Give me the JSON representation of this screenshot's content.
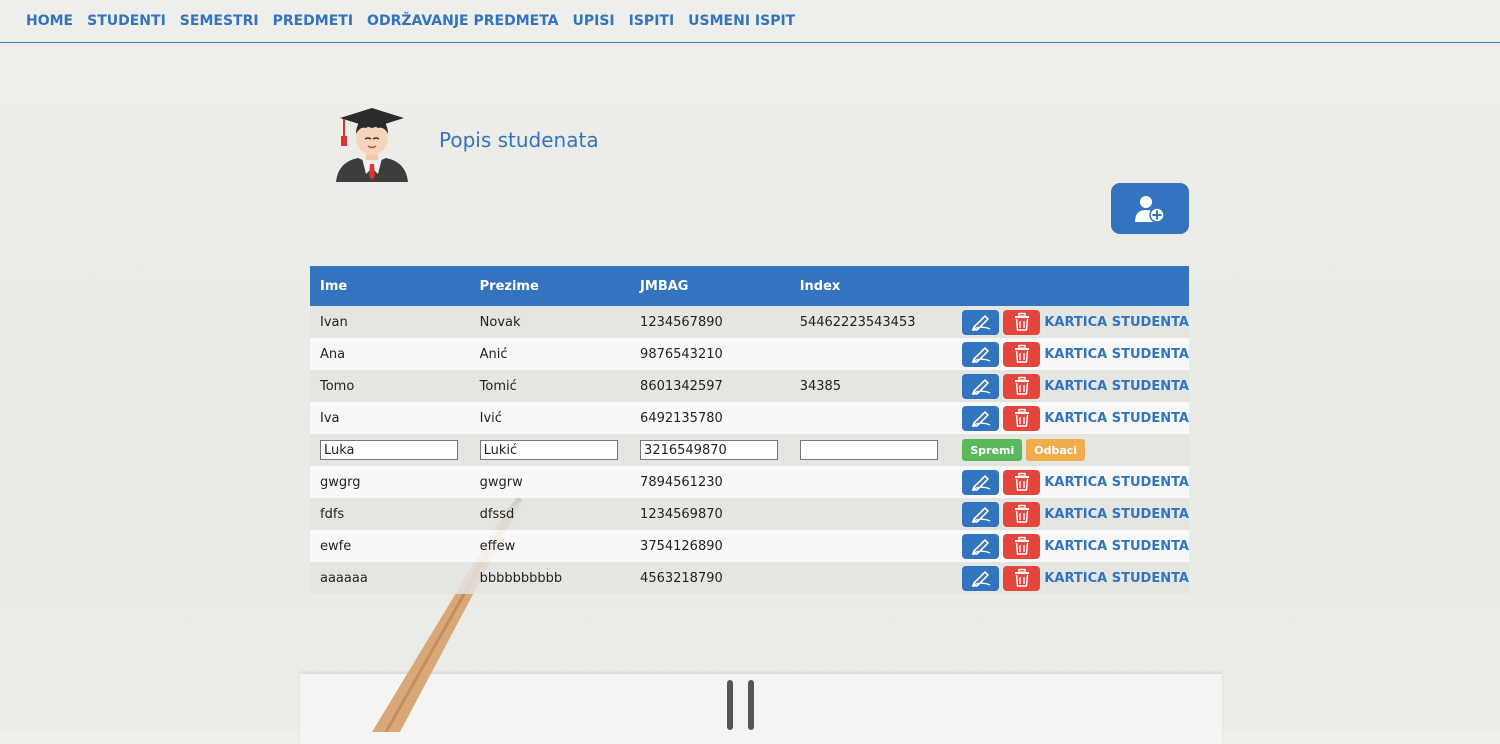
{
  "nav": {
    "items": [
      "HOME",
      "STUDENTI",
      "SEMESTRI",
      "PREDMETI",
      "ODRŽAVANJE PREDMETA",
      "UPISI",
      "ISPITI",
      "USMENI ISPIT"
    ]
  },
  "header": {
    "title": "Popis studenata",
    "avatar_icon": "student-graduate-icon",
    "add_icon": "add-user-icon"
  },
  "table": {
    "columns": [
      "Ime",
      "Prezime",
      "JMBAG",
      "Index"
    ],
    "action_label": "KARTICA STUDENTA",
    "rows": [
      {
        "ime": "Ivan",
        "prezime": "Novak",
        "jmbag": "1234567890",
        "index": "54462223543453"
      },
      {
        "ime": "Ana",
        "prezime": "Anić",
        "jmbag": "9876543210",
        "index": ""
      },
      {
        "ime": "Tomo",
        "prezime": "Tomić",
        "jmbag": "8601342597",
        "index": "34385"
      },
      {
        "ime": "Iva",
        "prezime": "Ivić",
        "jmbag": "6492135780",
        "index": ""
      },
      {
        "ime": "gwgrg",
        "prezime": "gwgrw",
        "jmbag": "7894561230",
        "index": ""
      },
      {
        "ime": "fdfs",
        "prezime": "dfssd",
        "jmbag": "1234569870",
        "index": ""
      },
      {
        "ime": "ewfe",
        "prezime": "effew",
        "jmbag": "3754126890",
        "index": ""
      },
      {
        "ime": "aaaaaa",
        "prezime": "bbbbbbbbbb",
        "jmbag": "4563218790",
        "index": ""
      }
    ],
    "editing_row": {
      "ime": "Luka",
      "prezime": "Lukić",
      "jmbag": "3216549870",
      "index": "",
      "save_label": "Spremi",
      "cancel_label": "Odbaci"
    }
  },
  "colors": {
    "accent": "#3274bd",
    "danger": "#e4453c",
    "success": "#5cb85c",
    "warning": "#f0ad4e"
  }
}
